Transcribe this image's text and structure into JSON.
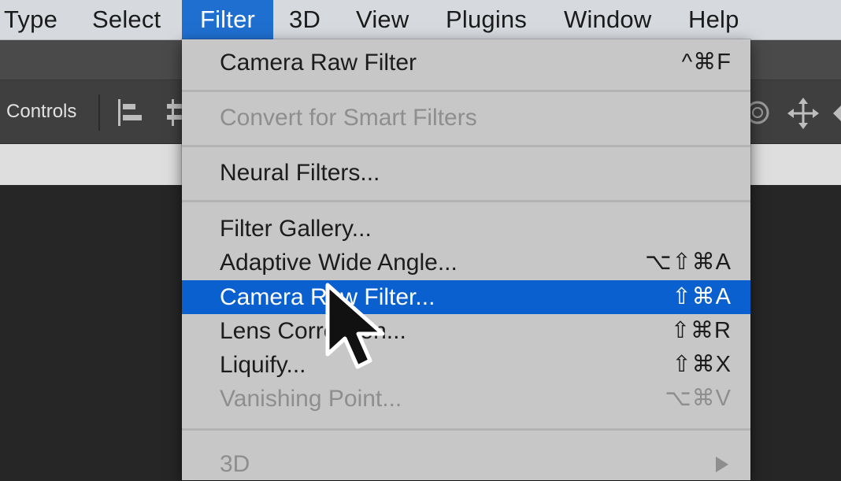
{
  "menubar": {
    "items": [
      {
        "label": "Type"
      },
      {
        "label": "Select"
      },
      {
        "label": "Filter"
      },
      {
        "label": "3D"
      },
      {
        "label": "View"
      },
      {
        "label": "Plugins"
      },
      {
        "label": "Window"
      },
      {
        "label": "Help"
      }
    ],
    "active": "Filter"
  },
  "options_bar": {
    "controls_label": "n Controls",
    "icons": [
      "align-left-icon",
      "distribute-icon",
      "orbit-icon",
      "move-3d-icon"
    ]
  },
  "filter_menu": {
    "items": [
      {
        "label": "Camera Raw Filter",
        "shortcut": "^⌘F",
        "enabled": true
      },
      {
        "label": "Convert for Smart Filters",
        "shortcut": "",
        "enabled": false
      },
      {
        "label": "Neural Filters...",
        "shortcut": "",
        "enabled": true
      },
      {
        "label": "Filter Gallery...",
        "shortcut": "",
        "enabled": true
      },
      {
        "label": "Adaptive Wide Angle...",
        "shortcut": "⌥⇧⌘A",
        "enabled": true
      },
      {
        "label": "Camera Raw Filter...",
        "shortcut": "⇧⌘A",
        "enabled": true,
        "highlighted": true
      },
      {
        "label": "Lens Correction...",
        "shortcut": "⇧⌘R",
        "enabled": true
      },
      {
        "label": "Liquify...",
        "shortcut": "⇧⌘X",
        "enabled": true
      },
      {
        "label": "Vanishing Point...",
        "shortcut": "⌥⌘V",
        "enabled": false
      },
      {
        "label": "3D",
        "shortcut": "",
        "enabled": false,
        "submenu": true
      }
    ]
  },
  "colors": {
    "menu_highlight": "#0a60cf",
    "menubar_active": "#1f6fd0",
    "menu_background": "#c7c7c7",
    "disabled_text": "#8e8e8e"
  }
}
